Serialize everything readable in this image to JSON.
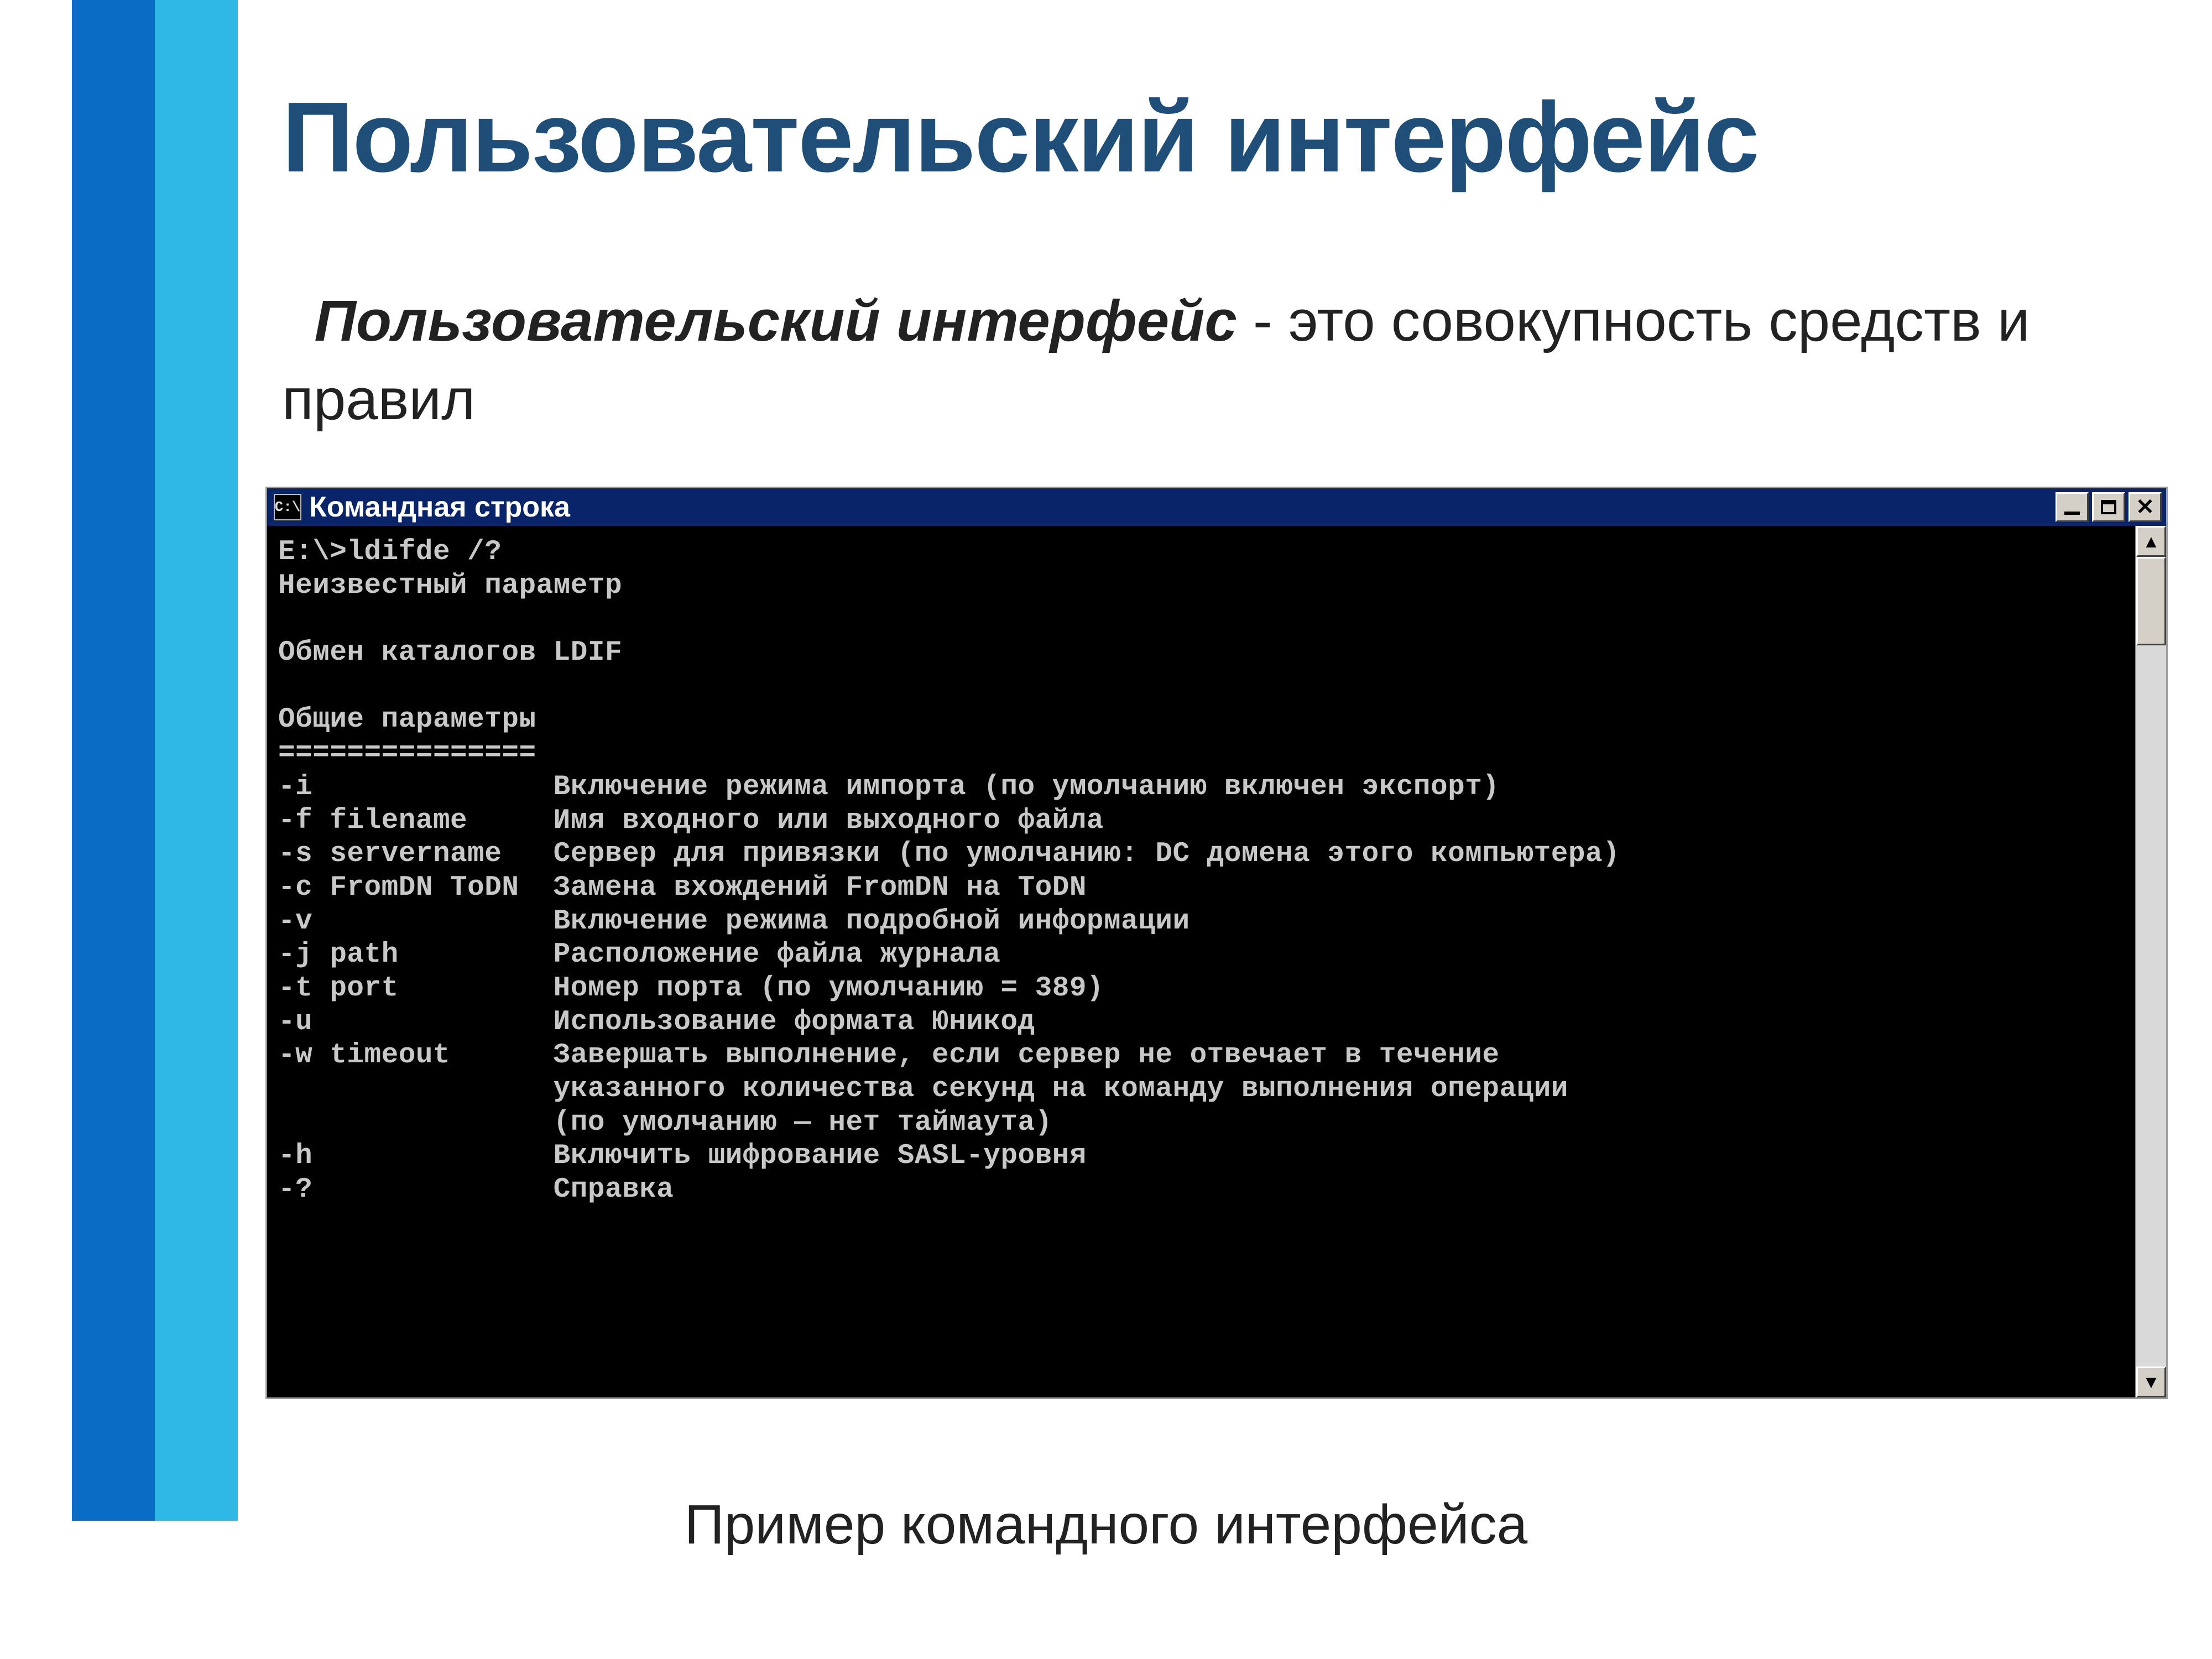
{
  "slide": {
    "title": "Пользовательский интерфейс",
    "body_bold": "Пользовательский интерфейс",
    "body_rest": " - это совокупность средств и правил",
    "caption": "Пример командного интерфейса"
  },
  "cmd": {
    "icon_text": "C:\\",
    "title": "Командная строка",
    "buttons": {
      "min": "_",
      "max": "☐",
      "close": "✕"
    },
    "scroll": {
      "up": "▲",
      "down": "▼"
    },
    "lines": [
      "E:\\>ldifde /?",
      "Неизвестный параметр",
      "",
      "Обмен каталогов LDIF",
      "",
      "Общие параметры",
      "===============",
      "-i              Включение режима импорта (по умолчанию включен экспорт)",
      "-f filename     Имя входного или выходного файла",
      "-s servername   Сервер для привязки (по умолчанию: DC домена этого компьютера)",
      "-c FromDN ToDN  Замена вхождений FromDN на ToDN",
      "-v              Включение режима подробной информации",
      "-j path         Расположение файла журнала",
      "-t port         Номер порта (по умолчанию = 389)",
      "-u              Использование формата Юникод",
      "-w timeout      Завершать выполнение, если сервер не отвечает в течение",
      "                указанного количества секунд на команду выполнения операции",
      "                (по умолчанию — нет таймаута)",
      "-h              Включить шифрование SASL-уровня",
      "-?              Справка",
      ""
    ]
  }
}
